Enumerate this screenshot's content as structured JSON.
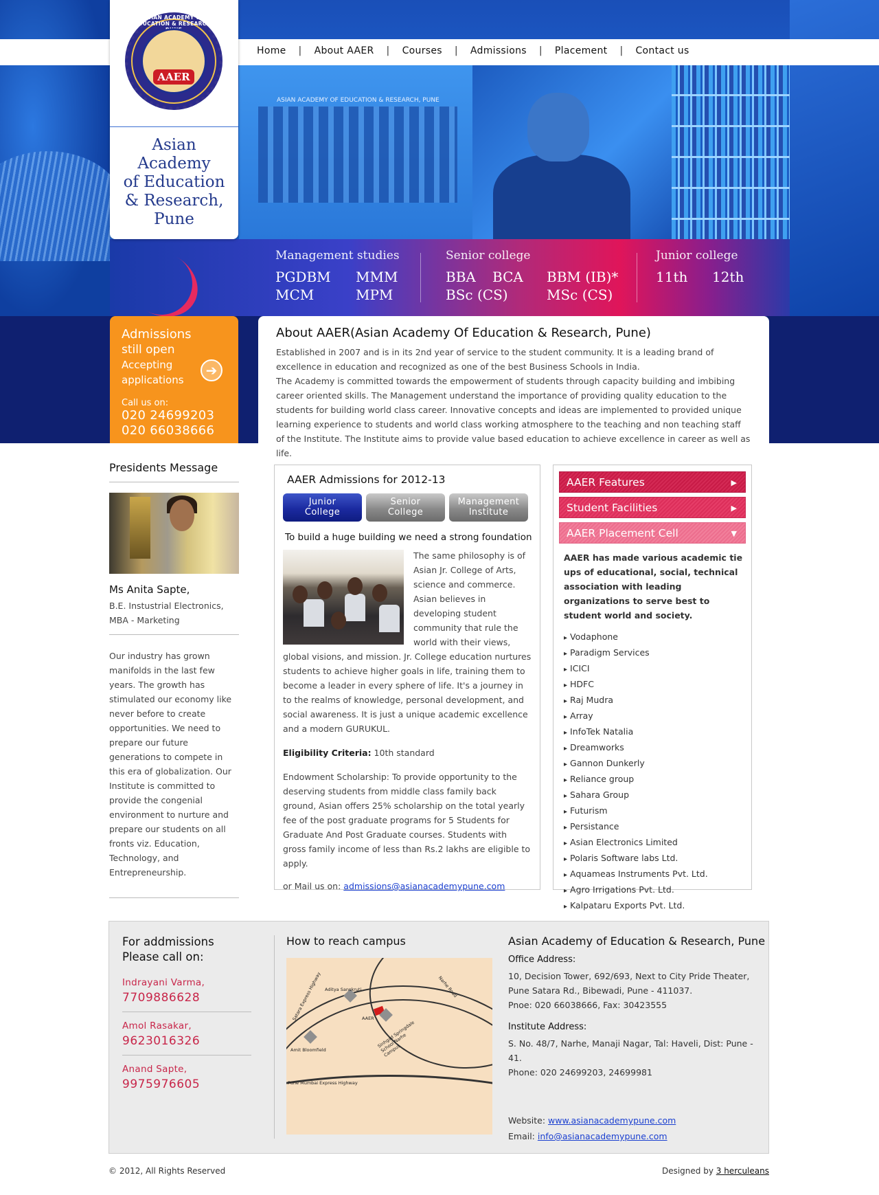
{
  "nav": {
    "items": [
      "Home",
      "About AAER",
      "Courses",
      "Admissions",
      "Placement",
      "Contact us"
    ]
  },
  "logo": {
    "emblem_text": "ASIAN ACADEMY OF EDUCATION & RESEARCH, PUNE",
    "badge": "AAER",
    "name_lines": [
      "Asian",
      "Academy",
      "of Education",
      "& Research,",
      "Pune"
    ]
  },
  "hero": {
    "building_sign": "ASIAN ACADEMY OF EDUCATION & RESEARCH, PUNE"
  },
  "courses": {
    "management": {
      "heading": "Management studies",
      "row1": [
        "PGDBM",
        "MMM"
      ],
      "row2": [
        "MCM",
        "MPM"
      ]
    },
    "senior": {
      "heading": "Senior college",
      "row1": [
        "BBA",
        "BCA",
        "BBM (IB)*"
      ],
      "row2": [
        "BSc (CS)",
        "MSc (CS)"
      ]
    },
    "junior": {
      "heading": "Junior college",
      "row1": [
        "11th",
        "12th"
      ]
    }
  },
  "admissions_box": {
    "line1": "Admissions",
    "line2": "still open",
    "line3": "Accepting",
    "line4": "applications",
    "call_label": "Call us on:",
    "phones": [
      "020 24699203",
      "020 66038666"
    ],
    "arrow_icon": "arrow-right-icon"
  },
  "about": {
    "title": "About AAER(Asian Academy Of Education & Research, Pune)",
    "para1": "Established in 2007 and is in its 2nd year of service to the student community. It is a leading brand of excellence in education and recognized as one of the best Business Schools in India.",
    "para2": "The Academy is committed towards the empowerment of students through capacity building and imbibing career oriented skills. The Management understand the importance of providing quality education to the students for building world class career. Innovative concepts and ideas are implemented to provided unique learning experience to students and world class working atmosphere to the teaching and non teaching staff of the Institute. The Institute aims to provide value based education to achieve excellence in career as well as life."
  },
  "president": {
    "heading": "Presidents Message",
    "name": "Ms Anita Sapte,",
    "qual1": "B.E. Instustrial Electronics,",
    "qual2": "MBA - Marketing",
    "message": "Our industry has grown manifolds in the last few years. The growth has stimulated our economy like never before to create opportunities. We need to prepare our future generations to compete in this era of globalization. Our Institute is committed to provide the congenial environment to nurture and prepare our students on all fronts viz. Education, Technology, and Entrepreneurship."
  },
  "admissions_section": {
    "title": "AAER Admissions for 2012-13",
    "tabs": [
      {
        "l1": "Junior",
        "l2": "College"
      },
      {
        "l1": "Senior",
        "l2": "College"
      },
      {
        "l1": "Management",
        "l2": "Institute"
      }
    ],
    "subtitle": "To build a huge building we need a strong foundation",
    "body": "The same philosophy is of Asian Jr. College of Arts, science and commerce. Asian believes in developing student community that rule the world with their views, global visions, and mission. Jr. College education nurtures students to achieve higher goals in life, training them to become a leader in every sphere of life. It's a journey in to the realms of knowledge, personal development, and social awareness. It is just a unique academic excellence and a modern GURUKUL.",
    "eligibility_label": "Eligibility Criteria:",
    "eligibility_value": " 10th standard",
    "scholarship": "Endowment Scholarship: To provide opportunity to the deserving students from middle class family back ground, Asian offers 25% scholarship on the total yearly fee of the post graduate programs for 5 Students for Graduate And Post Graduate courses. Students with gross family income of less than Rs.2 lakhs are eligible to apply.",
    "mail_label": "or Mail us on: ",
    "mail": "admissions@asianacademypune.com"
  },
  "features": {
    "accordion": [
      "AAER Features",
      "Student Facilities",
      "AAER Placement Cell"
    ],
    "intro": "AAER has made various academic tie ups of educational, social, technical association with leading organizations to serve best to student world and society.",
    "partners": [
      "Vodaphone",
      "Paradigm Services",
      "ICICI",
      "HDFC",
      "Raj Mudra",
      "Array",
      "InfoTek Natalia",
      "Dreamworks",
      "Gannon Dunkerly",
      "Reliance group",
      "Sahara Group",
      "Futurism",
      "Persistance",
      "Asian Electronics Limited",
      "Polaris Software labs Ltd.",
      "Aquameas Instruments Pvt. Ltd.",
      "Agro Irrigations Pvt. Ltd.",
      "Kalpataru Exports Pvt. Ltd."
    ]
  },
  "footer": {
    "call_title1": "For addmissions",
    "call_title2": "Please call on:",
    "contacts": [
      {
        "name": "Indrayani Varma,",
        "phone": "7709886628"
      },
      {
        "name": "Amol Rasakar,",
        "phone": "9623016326"
      },
      {
        "name": "Anand Sapte,",
        "phone": "9975976605"
      }
    ],
    "map_title": "How to reach campus",
    "map_labels": {
      "aditya": "Aditya Sanskruti",
      "aaer": "AAER",
      "sinhgad": "Sinhgad Springdale School Narhe Campus",
      "amit": "Amit Bloomfield",
      "satara": "Satara Express Highway",
      "narhe": "Narhe Road",
      "mumbai": "Pune Mumbai Express Highway"
    },
    "org": "Asian Academy of Education & Research, Pune",
    "office_label": "Office Address:",
    "office1": "10, Decision Tower, 692/693, Next to City Pride Theater,",
    "office2": "Pune Satara Rd., Bibewadi, Pune - 411037.",
    "office3": "Pnoe: 020 66038666,  Fax: 30423555",
    "inst_label": "Institute Address:",
    "inst1": "S. No. 48/7, Narhe, Manaji Nagar, Tal: Haveli, Dist: Pune - 41.",
    "inst2": "Phone: 020 24699203, 24699981",
    "website_label": "Website: ",
    "website": "www.asianacademypune.com",
    "email_label": "Email: ",
    "email": "info@asianacademypune.com"
  },
  "bottom": {
    "copyright": "©  2012, All Rights Reserved",
    "designed_label": "Designed by ",
    "designer": "3 herculeans"
  }
}
